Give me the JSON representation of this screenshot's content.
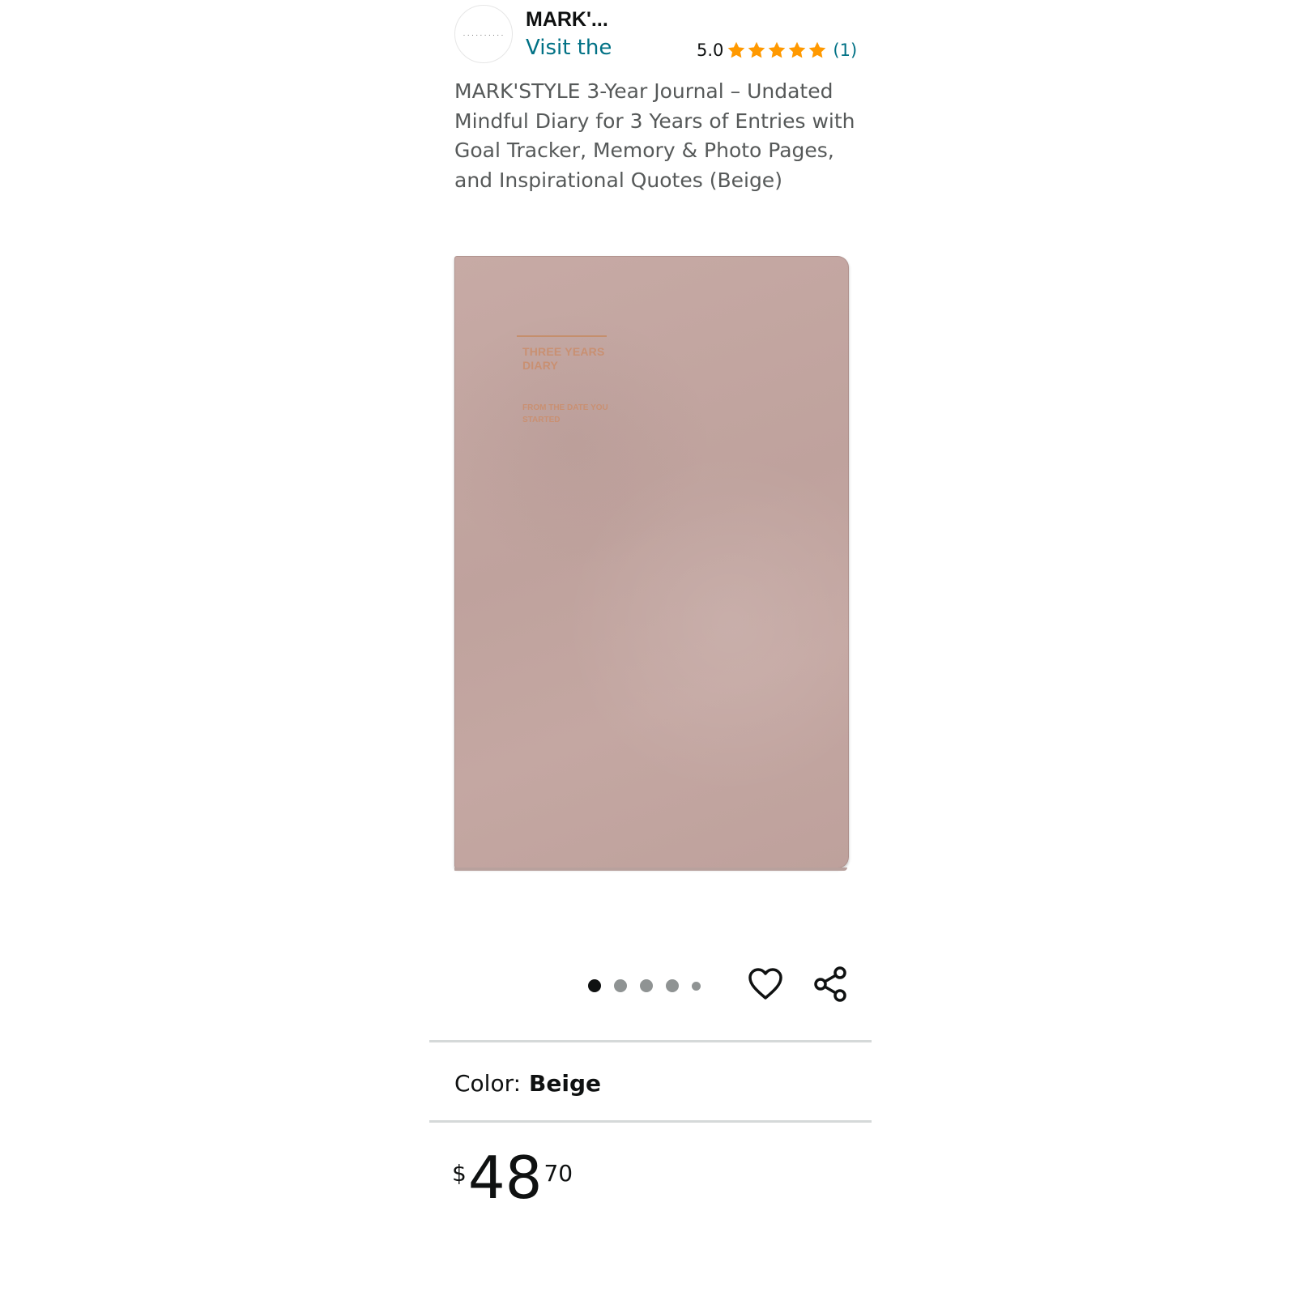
{
  "brand": {
    "logo_text": "..........",
    "name": "MARK'...",
    "visit_label": "Visit the"
  },
  "rating": {
    "value": "5.0",
    "stars": 5,
    "count": "(1)",
    "star_color": "#ff9900"
  },
  "product": {
    "title": "MARK'STYLE 3-Year Journal – Undated Mindful Diary for 3 Years of Entries with Goal Tracker, Memory & Photo Pages, and Inspirational Quotes (Beige)",
    "image": {
      "cover_title": "THREE YEARS DIARY",
      "cover_subtitle": "FROM THE DATE YOU STARTED",
      "cover_color": "#c4a7a2"
    }
  },
  "carousel": {
    "total_dots": 5,
    "active_index": 0
  },
  "actions": {
    "wishlist_icon": "heart-outline-icon",
    "share_icon": "share-icon"
  },
  "variation": {
    "label": "Color:",
    "value": "Beige"
  },
  "price": {
    "symbol": "$",
    "whole": "48",
    "fraction": "70"
  },
  "colors": {
    "link": "#007185",
    "text": "#0f1111",
    "secondary_text": "#565959",
    "divider": "#d5d9d9"
  }
}
